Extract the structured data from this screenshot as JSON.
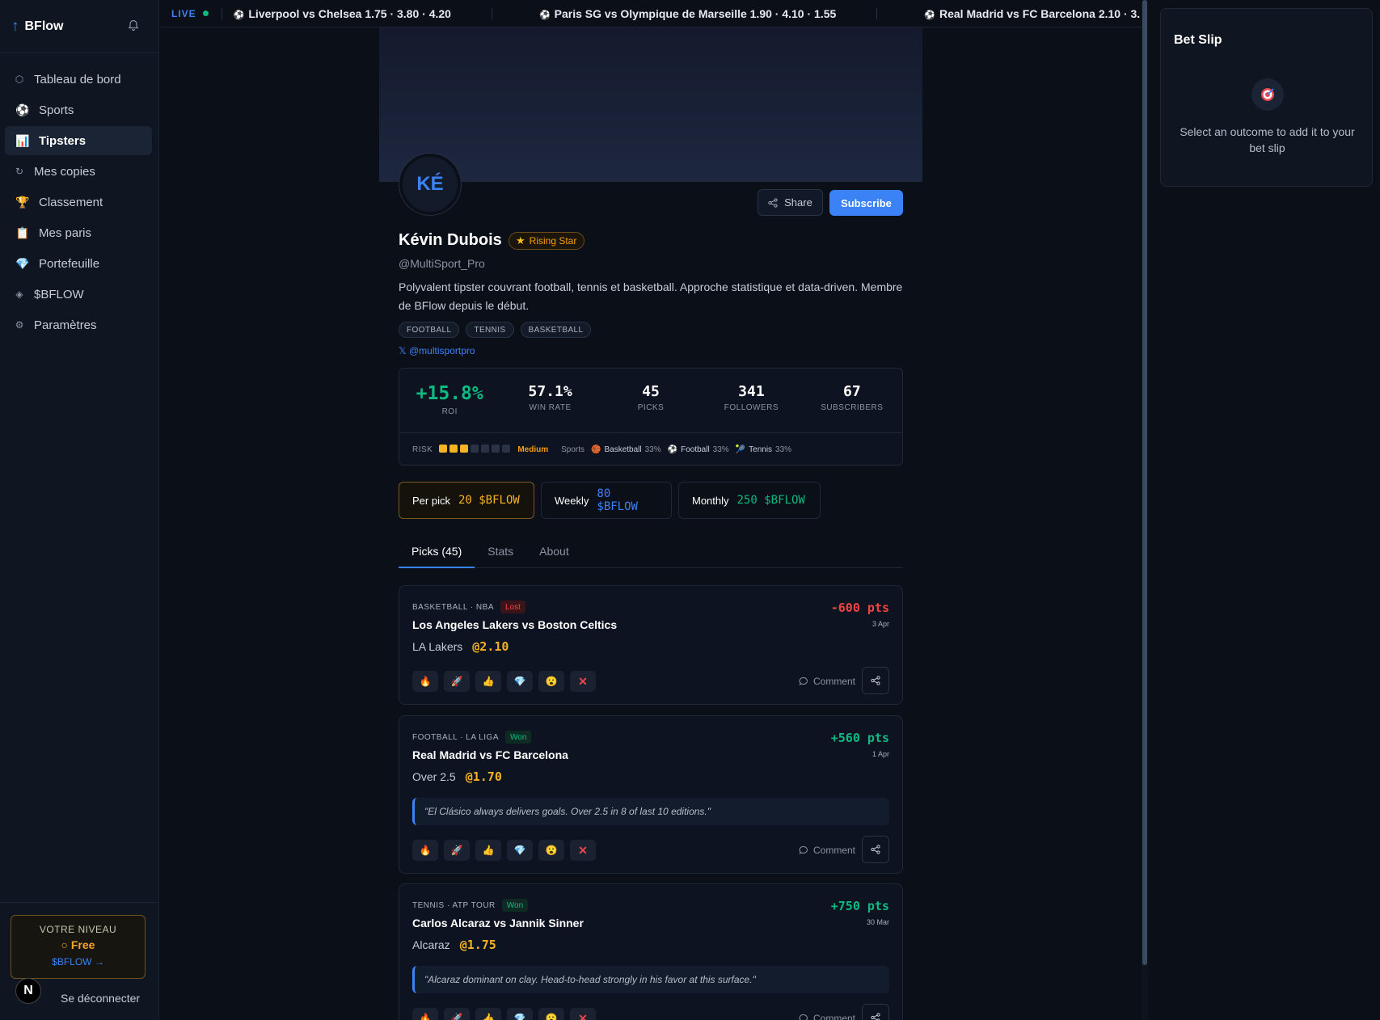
{
  "sidebar": {
    "brand": "BFlow",
    "items": [
      {
        "label": "Tableau de bord",
        "icon": "⬡"
      },
      {
        "label": "Sports",
        "icon": "⚽"
      },
      {
        "label": "Tipsters",
        "icon": "📊"
      },
      {
        "label": "Mes copies",
        "icon": "↻"
      },
      {
        "label": "Classement",
        "icon": "🏆"
      },
      {
        "label": "Mes paris",
        "icon": "📋"
      },
      {
        "label": "Portefeuille",
        "icon": "💎"
      },
      {
        "label": "$BFLOW",
        "icon": "◈"
      },
      {
        "label": "Paramètres",
        "icon": "⚙"
      }
    ],
    "level": {
      "label": "VOTRE NIVEAU",
      "value": "○ Free",
      "link": "$BFLOW →"
    },
    "logout": "Se déconnecter",
    "user_initial": "N"
  },
  "ticker": {
    "live": "LIVE",
    "matches": [
      "Liverpool vs Chelsea 1.75 · 3.80 · 4.20",
      "Paris SG vs Olympique de Marseille 1.90 · 4.10 · 1.55",
      "Real Madrid vs FC Barcelona 2.10 · 3."
    ]
  },
  "betslip": {
    "title": "Bet Slip",
    "hint": "Select an outcome to add it to your bet slip"
  },
  "profile": {
    "initials": "KÉ",
    "name": "Kévin Dubois",
    "badge": "Rising Star",
    "handle": "@MultiSport_Pro",
    "bio": "Polyvalent tipster couvrant football, tennis et basketball. Approche statistique et data-driven. Membre de BFlow depuis le début.",
    "tags": [
      "FOOTBALL",
      "TENNIS",
      "BASKETBALL"
    ],
    "x_link": "𝕏 @multisportpro",
    "share": "Share",
    "subscribe": "Subscribe"
  },
  "stats": {
    "roi": {
      "value": "+15.8%",
      "label": "ROI"
    },
    "win_rate": {
      "value": "57.1%",
      "label": "WIN RATE"
    },
    "picks": {
      "value": "45",
      "label": "PICKS"
    },
    "followers": {
      "value": "341",
      "label": "FOLLOWERS"
    },
    "subscribers": {
      "value": "67",
      "label": "SUBSCRIBERS"
    },
    "risk_label": "RISK",
    "risk_level": 3,
    "risk_max": 7,
    "risk_value": "Medium",
    "sports_label": "Sports",
    "sports": [
      {
        "name": "Basketball",
        "pct": "33%",
        "icon": "🏀"
      },
      {
        "name": "Football",
        "pct": "33%",
        "icon": "⚽"
      },
      {
        "name": "Tennis",
        "pct": "33%",
        "icon": "🎾"
      }
    ]
  },
  "prices": [
    {
      "label": "Per pick",
      "amount": "20 $BFLOW",
      "color": "#f5b324"
    },
    {
      "label": "Weekly",
      "amount": "80 $BFLOW",
      "color": "#3b82f6"
    },
    {
      "label": "Monthly",
      "amount": "250 $BFLOW",
      "color": "#10b981"
    }
  ],
  "tabs": [
    "Picks (45)",
    "Stats",
    "About"
  ],
  "reactions": [
    "🔥",
    "🚀",
    "👍",
    "💎",
    "😮",
    "✕"
  ],
  "comment_label": "Comment",
  "picks": [
    {
      "meta": "BASKETBALL · NBA",
      "status": "Lost",
      "title": "Los Angeles Lakers vs Boston Celtics",
      "selection": "LA Lakers",
      "odds": "@2.10",
      "pts": "-600 pts",
      "date": "3 Apr"
    },
    {
      "meta": "FOOTBALL · LA LIGA",
      "status": "Won",
      "title": "Real Madrid vs FC Barcelona",
      "selection": "Over 2.5",
      "odds": "@1.70",
      "pts": "+560 pts",
      "date": "1 Apr",
      "quote": "\"El Clásico always delivers goals. Over 2.5 in 8 of last 10 editions.\""
    },
    {
      "meta": "TENNIS · ATP TOUR",
      "status": "Won",
      "title": "Carlos Alcaraz vs Jannik Sinner",
      "selection": "Alcaraz",
      "odds": "@1.75",
      "pts": "+750 pts",
      "date": "30 Mar",
      "quote": "\"Alcaraz dominant on clay. Head-to-head strongly in his favor at this surface.\""
    }
  ]
}
